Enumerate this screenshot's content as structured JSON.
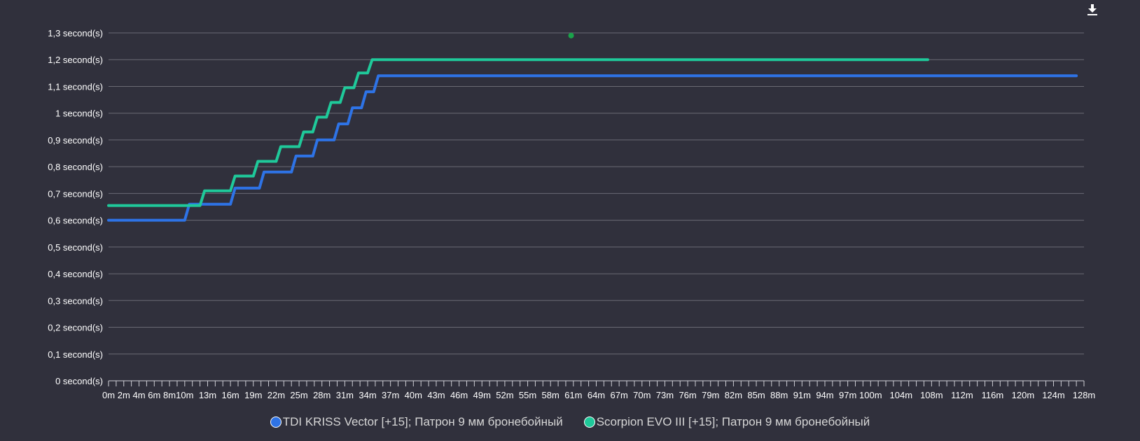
{
  "chart_data": {
    "type": "line",
    "title": "",
    "xlabel": "",
    "ylabel": "",
    "ylim": [
      0,
      1.3
    ],
    "xlim": [
      0,
      128
    ],
    "grid": true,
    "legend_position": "bottom-center",
    "y_ticks": [
      {
        "value": 0,
        "label": "0 second(s)"
      },
      {
        "value": 0.1,
        "label": "0,1 second(s)"
      },
      {
        "value": 0.2,
        "label": "0,2 second(s)"
      },
      {
        "value": 0.3,
        "label": "0,3 second(s)"
      },
      {
        "value": 0.4,
        "label": "0,4 second(s)"
      },
      {
        "value": 0.5,
        "label": "0,5 second(s)"
      },
      {
        "value": 0.6,
        "label": "0,6 second(s)"
      },
      {
        "value": 0.7,
        "label": "0,7 second(s)"
      },
      {
        "value": 0.8,
        "label": "0,8 second(s)"
      },
      {
        "value": 0.9,
        "label": "0,9 second(s)"
      },
      {
        "value": 1.0,
        "label": "1 second(s)"
      },
      {
        "value": 1.1,
        "label": "1,1 second(s)"
      },
      {
        "value": 1.2,
        "label": "1,2 second(s)"
      },
      {
        "value": 1.3,
        "label": "1,3 second(s)"
      }
    ],
    "x_tick_labels": [
      {
        "value": 0,
        "label": "0m"
      },
      {
        "value": 2,
        "label": "2m"
      },
      {
        "value": 4,
        "label": "4m"
      },
      {
        "value": 6,
        "label": "6m"
      },
      {
        "value": 8,
        "label": "8m"
      },
      {
        "value": 10,
        "label": "10m"
      },
      {
        "value": 13,
        "label": "13m"
      },
      {
        "value": 16,
        "label": "16m"
      },
      {
        "value": 19,
        "label": "19m"
      },
      {
        "value": 22,
        "label": "22m"
      },
      {
        "value": 25,
        "label": "25m"
      },
      {
        "value": 28,
        "label": "28m"
      },
      {
        "value": 31,
        "label": "31m"
      },
      {
        "value": 34,
        "label": "34m"
      },
      {
        "value": 37,
        "label": "37m"
      },
      {
        "value": 40,
        "label": "40m"
      },
      {
        "value": 43,
        "label": "43m"
      },
      {
        "value": 46,
        "label": "46m"
      },
      {
        "value": 49,
        "label": "49m"
      },
      {
        "value": 52,
        "label": "52m"
      },
      {
        "value": 55,
        "label": "55m"
      },
      {
        "value": 58,
        "label": "58m"
      },
      {
        "value": 61,
        "label": "61m"
      },
      {
        "value": 64,
        "label": "64m"
      },
      {
        "value": 67,
        "label": "67m"
      },
      {
        "value": 70,
        "label": "70m"
      },
      {
        "value": 73,
        "label": "73m"
      },
      {
        "value": 76,
        "label": "76m"
      },
      {
        "value": 79,
        "label": "79m"
      },
      {
        "value": 82,
        "label": "82m"
      },
      {
        "value": 85,
        "label": "85m"
      },
      {
        "value": 88,
        "label": "88m"
      },
      {
        "value": 91,
        "label": "91m"
      },
      {
        "value": 94,
        "label": "94m"
      },
      {
        "value": 97,
        "label": "97m"
      },
      {
        "value": 100,
        "label": "100m"
      },
      {
        "value": 104,
        "label": "104m"
      },
      {
        "value": 108,
        "label": "108m"
      },
      {
        "value": 112,
        "label": "112m"
      },
      {
        "value": 116,
        "label": "116m"
      },
      {
        "value": 120,
        "label": "120m"
      },
      {
        "value": 124,
        "label": "124m"
      },
      {
        "value": 128,
        "label": "128m"
      }
    ],
    "x_minor_tick_step": 1,
    "series": [
      {
        "name": "TDI KRISS Vector [+15]; Патрон 9 мм бронебойный",
        "color": "#2e73e6",
        "points": [
          [
            0,
            0.6
          ],
          [
            10,
            0.6
          ],
          [
            10.6,
            0.66
          ],
          [
            16,
            0.66
          ],
          [
            16.6,
            0.72
          ],
          [
            19.8,
            0.72
          ],
          [
            20.4,
            0.78
          ],
          [
            24,
            0.78
          ],
          [
            24.6,
            0.84
          ],
          [
            26.8,
            0.84
          ],
          [
            27.4,
            0.9
          ],
          [
            29.6,
            0.9
          ],
          [
            30.2,
            0.96
          ],
          [
            31.4,
            0.96
          ],
          [
            32,
            1.02
          ],
          [
            33.2,
            1.02
          ],
          [
            33.8,
            1.08
          ],
          [
            34.8,
            1.08
          ],
          [
            35.4,
            1.14
          ],
          [
            127,
            1.14
          ]
        ]
      },
      {
        "name": "Scorpion EVO III [+15]; Патрон 9 мм бронебойный",
        "color": "#1fc99a",
        "points": [
          [
            0,
            0.655
          ],
          [
            12,
            0.655
          ],
          [
            12.6,
            0.71
          ],
          [
            16,
            0.71
          ],
          [
            16.6,
            0.765
          ],
          [
            19,
            0.765
          ],
          [
            19.6,
            0.82
          ],
          [
            22,
            0.82
          ],
          [
            22.6,
            0.875
          ],
          [
            25,
            0.875
          ],
          [
            25.6,
            0.93
          ],
          [
            26.8,
            0.93
          ],
          [
            27.4,
            0.985
          ],
          [
            28.6,
            0.985
          ],
          [
            29.2,
            1.04
          ],
          [
            30.4,
            1.04
          ],
          [
            31,
            1.095
          ],
          [
            32.2,
            1.095
          ],
          [
            32.8,
            1.15
          ],
          [
            34,
            1.15
          ],
          [
            34.6,
            1.2
          ],
          [
            107.5,
            1.2
          ]
        ]
      }
    ],
    "annotations": [
      {
        "type": "marker",
        "x": 60.7,
        "y": 1.29,
        "color": "#1aa34a"
      }
    ]
  },
  "toolbar": {
    "download_icon": "download-icon"
  }
}
